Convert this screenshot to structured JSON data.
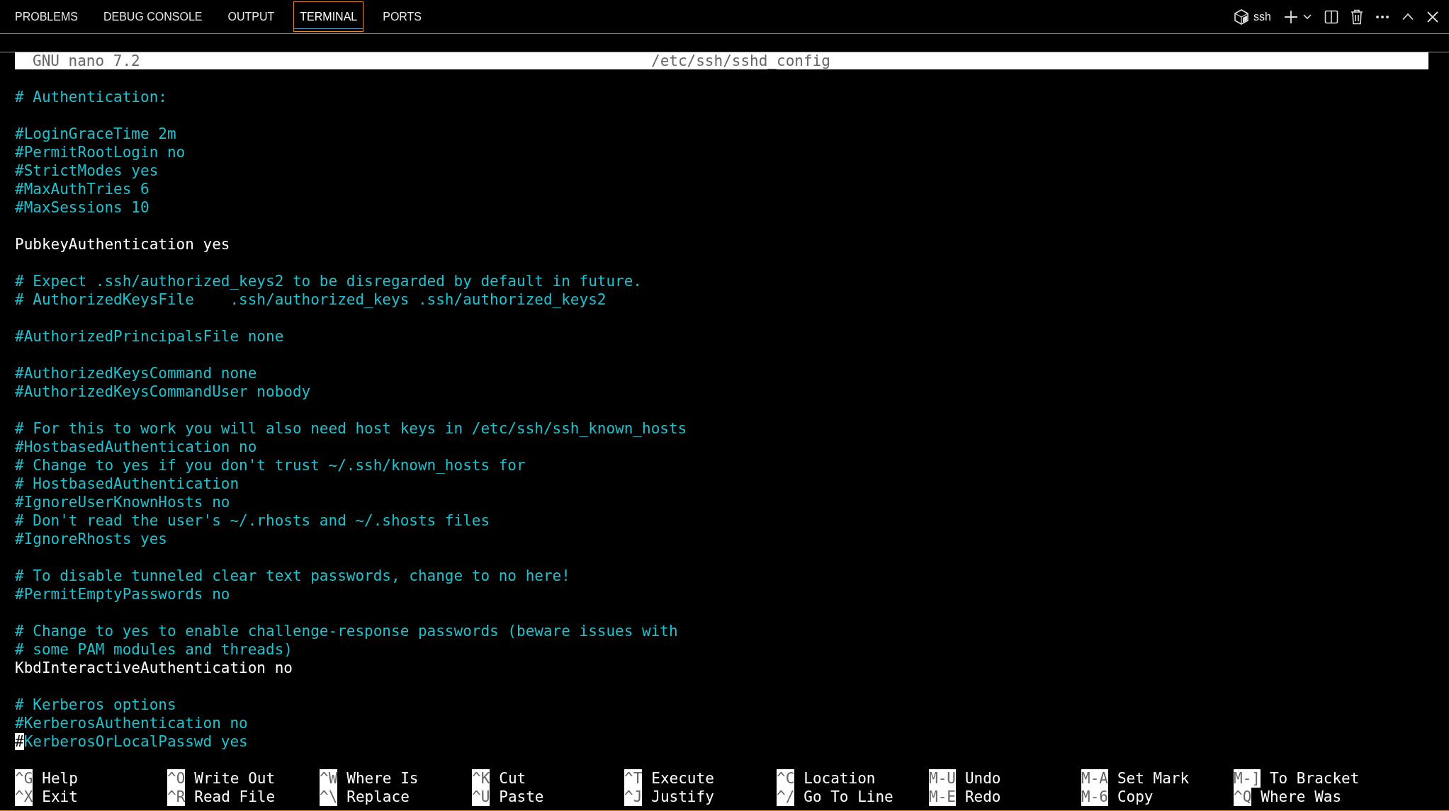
{
  "panel_tabs": [
    {
      "label": "PROBLEMS",
      "selected": false
    },
    {
      "label": "DEBUG CONSOLE",
      "selected": false
    },
    {
      "label": "OUTPUT",
      "selected": false
    },
    {
      "label": "TERMINAL",
      "selected": true
    },
    {
      "label": "PORTS",
      "selected": false
    }
  ],
  "terminal_name": "ssh",
  "nano": {
    "version": "GNU nano 7.2",
    "filename": "/etc/ssh/sshd_config",
    "lines": [
      {
        "kind": "blank"
      },
      {
        "kind": "comment",
        "text": "# Authentication:",
        "cursor": false
      },
      {
        "kind": "blank"
      },
      {
        "kind": "comment",
        "text": "#LoginGraceTime 2m",
        "cursor": false
      },
      {
        "kind": "comment",
        "text": "#PermitRootLogin no",
        "cursor": false
      },
      {
        "kind": "comment",
        "text": "#StrictModes yes",
        "cursor": false
      },
      {
        "kind": "comment",
        "text": "#MaxAuthTries 6",
        "cursor": false
      },
      {
        "kind": "comment",
        "text": "#MaxSessions 10",
        "cursor": false
      },
      {
        "kind": "blank"
      },
      {
        "kind": "directive",
        "text": "PubkeyAuthentication yes",
        "cursor": false
      },
      {
        "kind": "blank"
      },
      {
        "kind": "comment",
        "text": "# Expect .ssh/authorized_keys2 to be disregarded by default in future.",
        "cursor": false
      },
      {
        "kind": "comment",
        "text": "# AuthorizedKeysFile    .ssh/authorized_keys .ssh/authorized_keys2",
        "cursor": false
      },
      {
        "kind": "blank"
      },
      {
        "kind": "comment",
        "text": "#AuthorizedPrincipalsFile none",
        "cursor": false
      },
      {
        "kind": "blank"
      },
      {
        "kind": "comment",
        "text": "#AuthorizedKeysCommand none",
        "cursor": false
      },
      {
        "kind": "comment",
        "text": "#AuthorizedKeysCommandUser nobody",
        "cursor": false
      },
      {
        "kind": "blank"
      },
      {
        "kind": "comment",
        "text": "# For this to work you will also need host keys in /etc/ssh/ssh_known_hosts",
        "cursor": false
      },
      {
        "kind": "comment",
        "text": "#HostbasedAuthentication no",
        "cursor": false
      },
      {
        "kind": "comment",
        "text": "# Change to yes if you don't trust ~/.ssh/known_hosts for",
        "cursor": false
      },
      {
        "kind": "comment",
        "text": "# HostbasedAuthentication",
        "cursor": false
      },
      {
        "kind": "comment",
        "text": "#IgnoreUserKnownHosts no",
        "cursor": false
      },
      {
        "kind": "comment",
        "text": "# Don't read the user's ~/.rhosts and ~/.shosts files",
        "cursor": false
      },
      {
        "kind": "comment",
        "text": "#IgnoreRhosts yes",
        "cursor": false
      },
      {
        "kind": "blank"
      },
      {
        "kind": "comment",
        "text": "# To disable tunneled clear text passwords, change to no here!",
        "cursor": false
      },
      {
        "kind": "comment",
        "text": "#PermitEmptyPasswords no",
        "cursor": false
      },
      {
        "kind": "blank"
      },
      {
        "kind": "comment",
        "text": "# Change to yes to enable challenge-response passwords (beware issues with",
        "cursor": false
      },
      {
        "kind": "comment",
        "text": "# some PAM modules and threads)",
        "cursor": false
      },
      {
        "kind": "directive",
        "text": "KbdInteractiveAuthentication no",
        "cursor": false
      },
      {
        "kind": "blank"
      },
      {
        "kind": "comment",
        "text": "# Kerberos options",
        "cursor": false
      },
      {
        "kind": "comment",
        "text": "#KerberosAuthentication no",
        "cursor": false
      },
      {
        "kind": "comment",
        "text": "#KerberosOrLocalPasswd yes",
        "cursor": true
      }
    ],
    "shortcuts": [
      [
        {
          "key": "^G",
          "label": "Help"
        },
        {
          "key": "^X",
          "label": "Exit"
        }
      ],
      [
        {
          "key": "^O",
          "label": "Write Out"
        },
        {
          "key": "^R",
          "label": "Read File"
        }
      ],
      [
        {
          "key": "^W",
          "label": "Where Is"
        },
        {
          "key": "^\\",
          "label": "Replace"
        }
      ],
      [
        {
          "key": "^K",
          "label": "Cut"
        },
        {
          "key": "^U",
          "label": "Paste"
        }
      ],
      [
        {
          "key": "^T",
          "label": "Execute"
        },
        {
          "key": "^J",
          "label": "Justify"
        }
      ],
      [
        {
          "key": "^C",
          "label": "Location"
        },
        {
          "key": "^/",
          "label": "Go To Line"
        }
      ],
      [
        {
          "key": "M-U",
          "label": "Undo"
        },
        {
          "key": "M-E",
          "label": "Redo"
        }
      ],
      [
        {
          "key": "M-A",
          "label": "Set Mark"
        },
        {
          "key": "M-6",
          "label": "Copy"
        }
      ],
      [
        {
          "key": "M-]",
          "label": "To Bracket"
        },
        {
          "key": "^Q",
          "label": "Where Was"
        }
      ]
    ]
  }
}
